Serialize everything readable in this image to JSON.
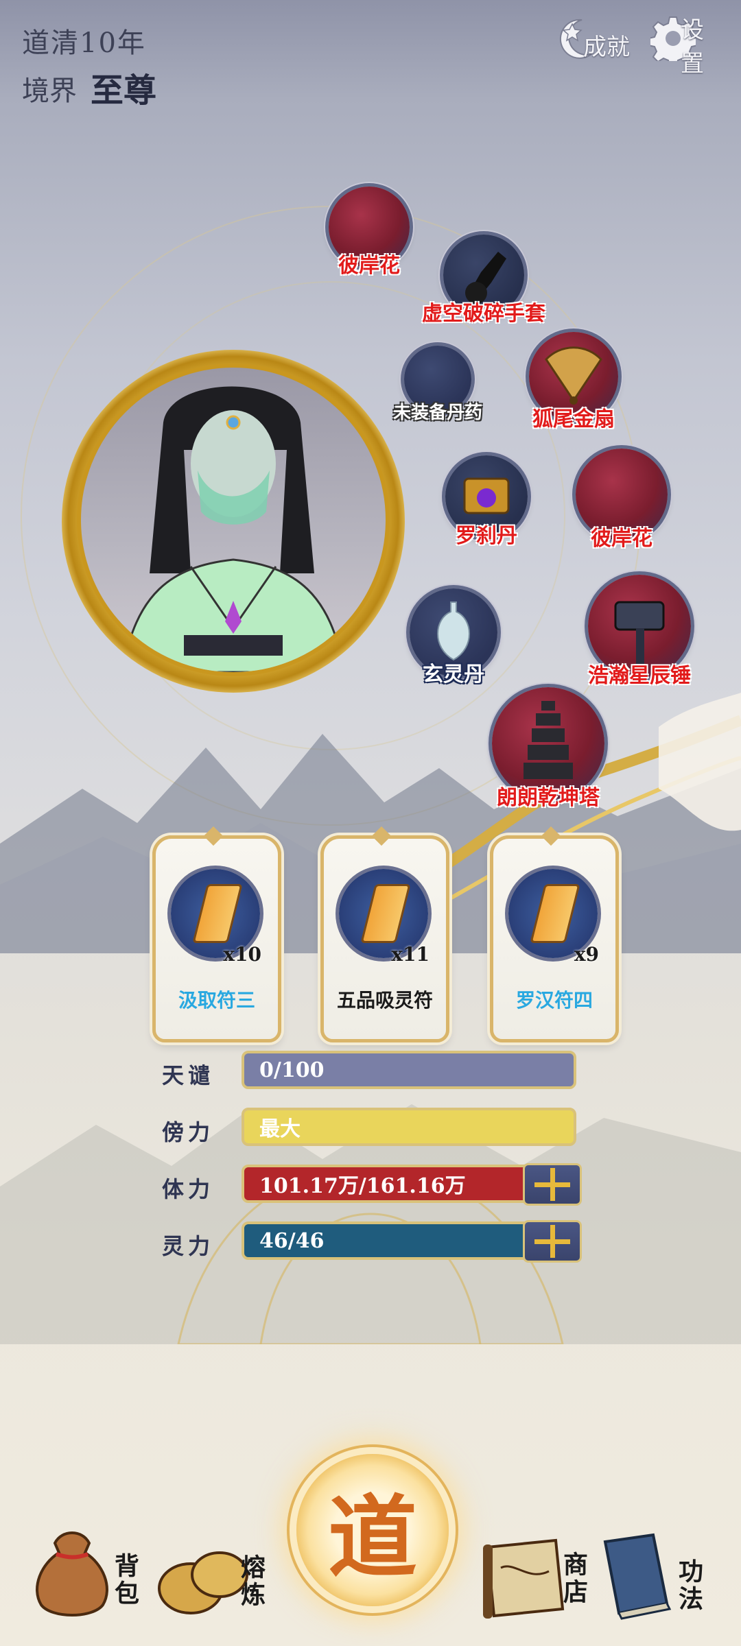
{
  "header": {
    "year": "道清10年",
    "realm_label": "境界",
    "realm_value": "至尊",
    "achievements_label": "成就",
    "settings_label": "设置"
  },
  "equipment": [
    {
      "label": "彼岸花",
      "icon": "red-flower-orb-icon"
    },
    {
      "label": "虚空破碎手套",
      "icon": "black-gauntlet-icon"
    },
    {
      "label": "未装备丹药",
      "icon": "empty-slot-icon"
    },
    {
      "label": "狐尾金扇",
      "icon": "golden-fan-icon"
    },
    {
      "label": "罗刹丹",
      "icon": "treasure-chest-icon"
    },
    {
      "label": "彼岸花",
      "icon": "red-flower-orb-icon"
    },
    {
      "label": "玄灵丹",
      "icon": "porcelain-vase-icon"
    },
    {
      "label": "浩瀚星辰锤",
      "icon": "war-hammer-icon"
    },
    {
      "label": "朗朗乾坤塔",
      "icon": "pagoda-icon"
    }
  ],
  "talismans": [
    {
      "name": "汲取符三",
      "count": "x10",
      "name_color": "#29a8e0"
    },
    {
      "name": "五品吸灵符",
      "count": "x11",
      "name_color": "#1a1a1a"
    },
    {
      "name": "罗汉符四",
      "count": "x9",
      "name_color": "#29a8e0"
    }
  ],
  "stats": [
    {
      "label": "天谴",
      "value": "0/100",
      "color": "#7a7fa6",
      "progress": 0,
      "has_plus": false
    },
    {
      "label": "傍力",
      "value": "最大",
      "color": "#e9d55b",
      "progress": 1,
      "has_plus": false
    },
    {
      "label": "体力",
      "value": "101.17万/161.16万",
      "color": "#b3262a",
      "progress": 0.63,
      "has_plus": true
    },
    {
      "label": "灵力",
      "value": "46/46",
      "color": "#1f5c7d",
      "progress": 1,
      "has_plus": true
    }
  ],
  "nav": {
    "bag": "背包",
    "smelt": "熔炼",
    "dao": "道",
    "shop": "商店",
    "skills": "功法"
  }
}
